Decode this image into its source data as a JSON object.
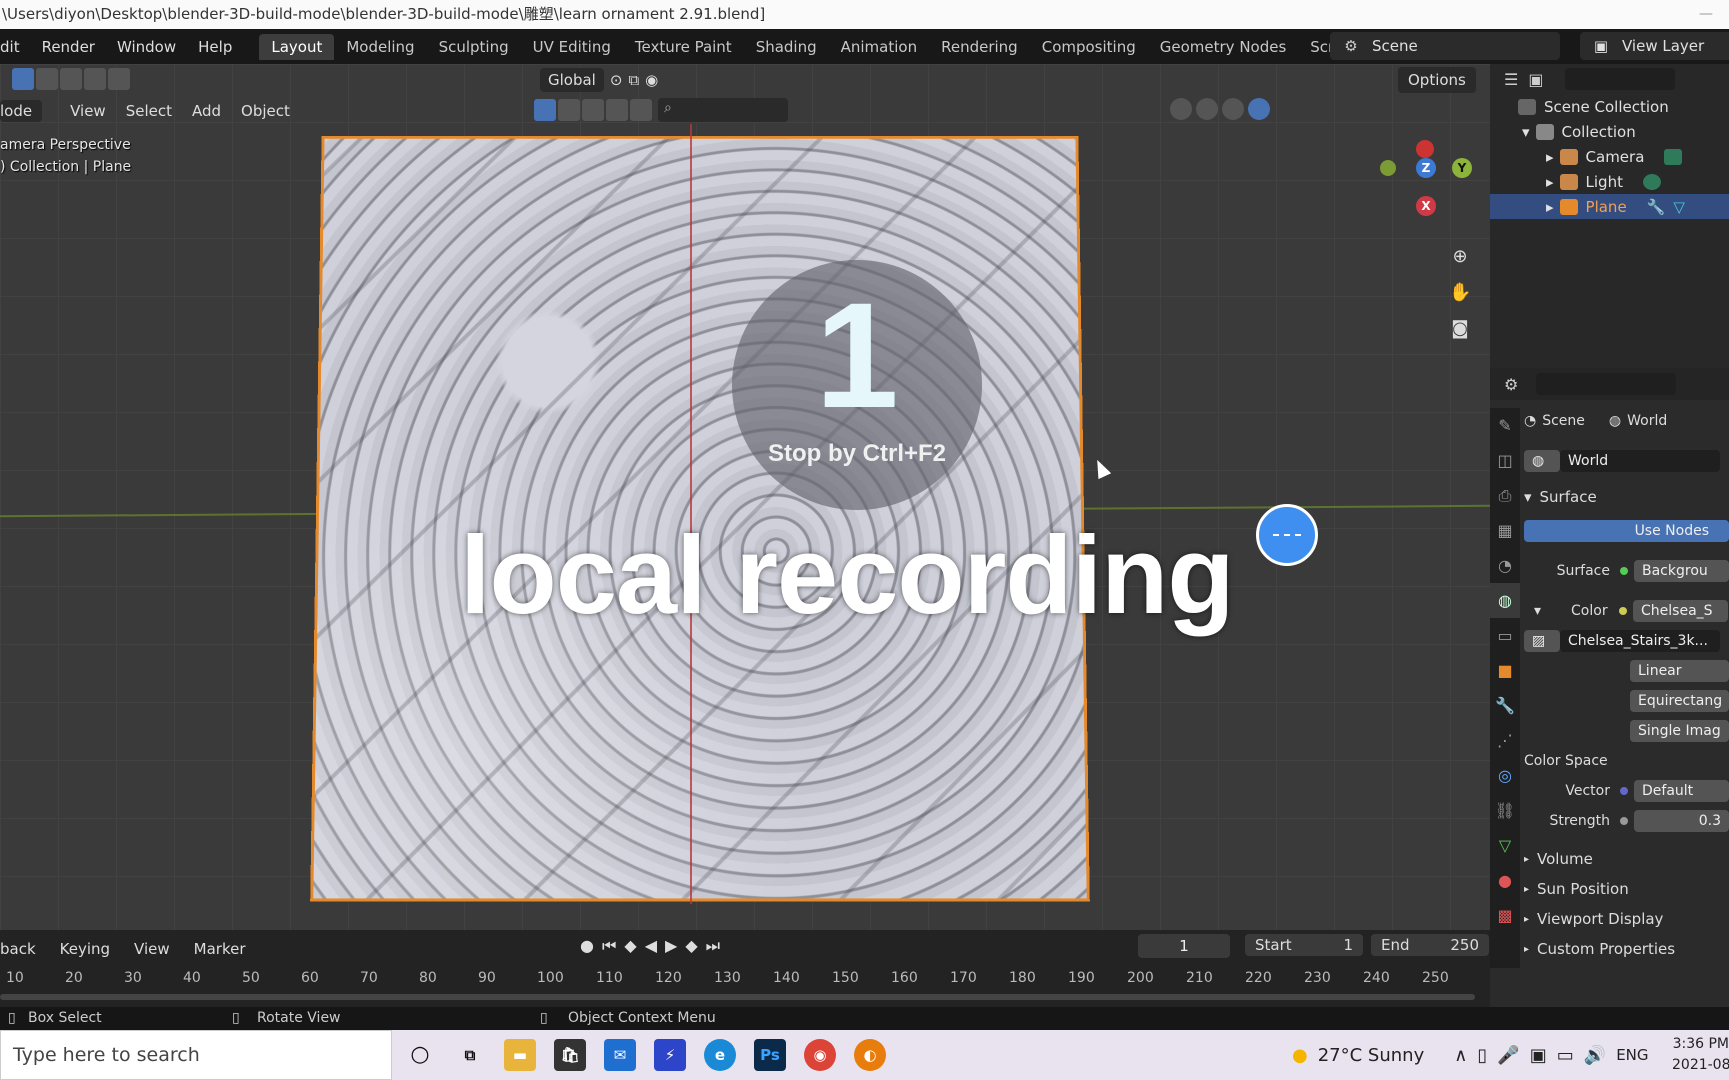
{
  "window": {
    "title": "\\Users\\diyon\\Desktop\\blender-3D-build-mode\\blender-3D-build-mode\\雕塑\\learn ornament 2.91.blend]",
    "min": "—",
    "max": "☐",
    "close": "✕"
  },
  "menu": {
    "items": [
      "dit",
      "Render",
      "Window",
      "Help"
    ],
    "workspaces": [
      "Layout",
      "Modeling",
      "Sculpting",
      "UV Editing",
      "Texture Paint",
      "Shading",
      "Animation",
      "Rendering",
      "Compositing",
      "Geometry Nodes",
      "Scripting"
    ],
    "active_workspace": "Layout",
    "add_label": "+",
    "scene": "Scene",
    "view_layer": "View Layer"
  },
  "viewport": {
    "orientation": "Global",
    "options": "Options",
    "mode": "lode",
    "menus": [
      "View",
      "Select",
      "Add",
      "Object"
    ],
    "info_line1": "amera Perspective",
    "info_line2": ") Collection | Plane"
  },
  "overlay": {
    "countdown": "1",
    "stop_hint": "Stop by Ctrl+F2",
    "banner": "local recording"
  },
  "gizmo": {
    "x": "X",
    "y": "Y",
    "z": "Z"
  },
  "timeline": {
    "menus": [
      "back",
      "Keying",
      "View",
      "Marker"
    ],
    "current_frame": "1",
    "start_label": "Start",
    "start_value": "1",
    "end_label": "End",
    "end_value": "250",
    "ruler": [
      "10",
      "20",
      "30",
      "40",
      "50",
      "60",
      "70",
      "80",
      "90",
      "100",
      "110",
      "120",
      "130",
      "140",
      "150",
      "160",
      "170",
      "180",
      "190",
      "200",
      "210",
      "220",
      "230",
      "240",
      "250"
    ]
  },
  "status": {
    "left": "Box Select",
    "middle": "Rotate View",
    "right": "Object Context Menu"
  },
  "outliner": {
    "root": "Scene Collection",
    "collection": "Collection",
    "items": [
      "Camera",
      "Light",
      "Plane"
    ],
    "selected": "Plane"
  },
  "properties": {
    "breadcrumb_scene": "Scene",
    "breadcrumb_world": "World",
    "world_name": "World",
    "surface_section": "Surface",
    "use_nodes": "Use Nodes",
    "surface_label": "Surface",
    "surface_value": "Backgrou",
    "color_label": "Color",
    "color_value": "Chelsea_S",
    "image_name": "Chelsea_Stairs_3k...",
    "interp": "Linear",
    "projection": "Equirectang",
    "source": "Single Imag",
    "colorspace_label": "Color Space",
    "vector_label": "Vector",
    "vector_value": "Default",
    "strength_label": "Strength",
    "strength_value": "0.3",
    "sections": [
      "Volume",
      "Sun Position",
      "Viewport Display",
      "Custom Properties"
    ]
  },
  "taskbar": {
    "search_placeholder": "Type here to search",
    "weather": "27°C  Sunny",
    "lang": "ENG",
    "time": "3:36 PM",
    "date": "2021-08"
  }
}
